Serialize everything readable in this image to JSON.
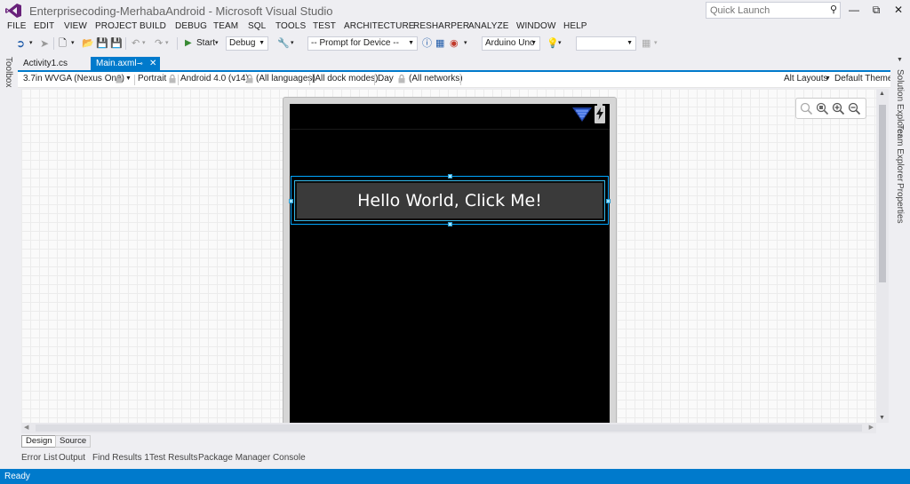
{
  "window": {
    "title": "Enterprisecoding-MerhabaAndroid - Microsoft Visual Studio",
    "quick_launch_placeholder": "Quick Launch",
    "minimize": "—",
    "restore": "⧉",
    "close": "✕"
  },
  "menu": [
    "FILE",
    "EDIT",
    "VIEW",
    "PROJECT",
    "BUILD",
    "DEBUG",
    "TEAM",
    "SQL",
    "TOOLS",
    "TEST",
    "ARCHITECTURE",
    "RESHARPER",
    "ANALYZE",
    "WINDOW",
    "HELP"
  ],
  "toolbar": {
    "start_label": "Start",
    "config_value": "Debug",
    "device_value": "-- Prompt for Device --",
    "board_value": "Arduino Uno"
  },
  "left_panel": {
    "toolbox_label": "Toolbox"
  },
  "right_panel": {
    "solution_explorer_label": "Solution Explorer",
    "team_explorer_label": "Team Explorer",
    "properties_label": "Properties"
  },
  "doc_tabs": [
    {
      "label": "Activity1.cs"
    },
    {
      "label": "Main.axml",
      "pin": "⊸",
      "close": "✕"
    }
  ],
  "designer_bar": {
    "device": "3.7in WVGA (Nexus One)",
    "orientation": "Portrait",
    "api": "Android 4.0 (v14)",
    "languages": "(All languages)",
    "dock_modes": "(All dock modes)",
    "night_mode": "Day",
    "networks": "(All networks)",
    "alt_layouts": "Alt Layouts",
    "theme": "Default Theme"
  },
  "layout_preview": {
    "button_text": "Hello World, Click Me!"
  },
  "view_tabs": [
    "Design",
    "Source"
  ],
  "bottom_tabs": [
    "Error List",
    "Output",
    "Find Results 1",
    "Test Results",
    "Package Manager Console"
  ],
  "status": {
    "text": "Ready"
  },
  "icons": {
    "logo": "visual-studio-logo-icon",
    "search": "search-icon",
    "lock": "lock-icon",
    "zoom": [
      "zoom-fit-icon",
      "zoom-actual-icon",
      "zoom-in-icon",
      "zoom-out-icon"
    ]
  },
  "colors": {
    "accent": "#007acc",
    "logo": "#68217a",
    "selection": "#00a6ff",
    "android_holo": "#33b5e5"
  }
}
